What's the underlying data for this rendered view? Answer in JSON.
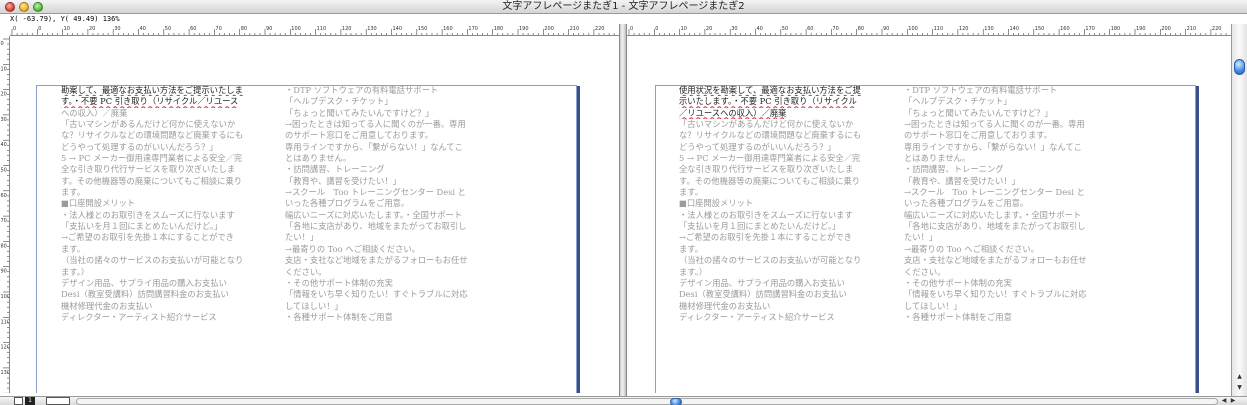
{
  "window": {
    "title": "文字アフレページまたぎ1 - 文字アフレページまたぎ2"
  },
  "coord_readout": "X( -63.79), Y( 49.49)  136%",
  "ruler": {
    "h_labels": [
      "0",
      "0",
      "10",
      "20",
      "30",
      "40",
      "50",
      "60",
      "70",
      "80",
      "90",
      "100",
      "110",
      "120",
      "130",
      "140",
      "150",
      "160",
      "170",
      "180",
      "190",
      "200",
      "210",
      "220"
    ],
    "v_labels": [
      "0",
      "10",
      "20",
      "30",
      "40",
      "50",
      "60",
      "70",
      "80",
      "90",
      "100",
      "110",
      "120",
      "130",
      "140",
      "150",
      "160",
      "170",
      "180",
      "190",
      "200",
      "210",
      "220"
    ]
  },
  "bottombar": {
    "page_number": "1",
    "scroll_left_arrow": "◀",
    "scroll_right_arrow": "▶"
  },
  "scroll": {
    "up_arrow": "▲",
    "down_arrow": "▼"
  },
  "left_pane": {
    "col1": [
      "勘案して、最適なお支払い方法をご提示いたしま",
      "す。・不要 PC 引き取り（リサイクル／リユース",
      "への収入）／廃棄",
      "「古いマシンがあるんだけど何かに使えないか",
      "な？リサイクルなどの環境問題など廃棄するにも",
      "どうやって処理するのがいいんだろう？」",
      "5 → PC メーカー御用達専門業者による安全／完",
      "全な引き取り代行サービスを取り次ぎいたしま",
      "す。その他機器等の廃棄についてもご相談に乗り",
      "ます。",
      "■口座開設メリット",
      "・法人様とのお取引きをスムーズに行ないます",
      "「支払いを月１回にまとめたいんだけど。」",
      "→ご希望のお取引を先掛１本にすることができ",
      "ます。",
      "（当社の諸々のサービスのお支払いが可能となり",
      "ます。）",
      "デザイン用品、サプライ用品の購入お支払い",
      "Desi（教室受講料）訪問講習料金のお支払い",
      "機材修理代金のお支払い",
      "ディレクター・アーティスト紹介サービス"
    ],
    "col2": [
      "・DTP ソフトウェアの有料電話サポート",
      "「ヘルプデスク・チケット」",
      "「ちょっと聞いてみたいんですけど？」",
      "→困ったときは知ってる人に聞くのが一番。専用",
      "のサポート窓口をご用意しております。",
      "専用ラインですから、「繋がらない！」なんてこ",
      "とはありません。",
      "・訪問講習、トレーニング",
      "「教育や、講習を受けたい！」",
      "→スクール　Too トレーニングセンター Desi と",
      "いった各種プログラムをご用意。",
      "幅広いニーズに対応いたします。・全国サポート",
      "「各地に支店があり、地域をまたがってお取引し",
      "たい！」",
      "→最寄りの Too へご相談ください。",
      "支店・支社など地域をまたがるフォローもお任せ",
      "ください。",
      "・その他サポート体制の充実",
      "「情報をいち早く知りたい！すぐトラブルに対応",
      "してほしい！」",
      "・各種サポート体制をご用意"
    ]
  },
  "right_pane": {
    "col1": [
      "使用状況を勘案して、最適なお支払い方法をご提",
      "示いたします。・不要 PC 引き取り（リサイクル",
      "／リユースへの収入）／廃棄",
      "「古いマシンがあるんだけど何かに使えないか",
      "な？リサイクルなどの環境問題など廃棄するにも",
      "どうやって処理するのがいいんだろう？」",
      "5 → PC メーカー御用達専門業者による安全／完",
      "全な引き取り代行サービスを取り次ぎいたしま",
      "す。その他機器等の廃棄についてもご相談に乗り",
      "ます。",
      "■口座開設メリット",
      "・法人様とのお取引きをスムーズに行ないます",
      "「支払いを月１回にまとめたいんだけど。」",
      "→ご希望のお取引を先掛１本にすることができ",
      "ます。",
      "（当社の諸々のサービスのお支払いが可能となり",
      "ます。）",
      "デザイン用品、サプライ用品の購入お支払い",
      "Desi（教室受講料）訪問講習料金のお支払い",
      "機材修理代金のお支払い",
      "ディレクター・アーティスト紹介サービス"
    ],
    "col2": [
      "・DTP ソフトウェアの有料電話サポート",
      "「ヘルプデスク・チケット」",
      "「ちょっと聞いてみたいんですけど？」",
      "→困ったときは知ってる人に聞くのが一番。専用",
      "のサポート窓口をご用意しております。",
      "専用ラインですから、「繋がらない！」なんてこ",
      "とはありません。",
      "・訪問講習、トレーニング",
      "「教育や、講習を受けたい！」",
      "→スクール　Too トレーニングセンター Desi と",
      "いった各種プログラムをご用意。",
      "幅広いニーズに対応いたします。・全国サポート",
      "「各地に支店があり、地域をまたがってお取引し",
      "たい！」",
      "→最寄りの Too へご相談ください。",
      "支店・支社など地域をまたがるフォローもお任せ",
      "ください。",
      "・その他サポート体制の充実",
      "「情報をいち早く知りたい！すぐトラブルに対応",
      "してほしい！」",
      "・各種サポート体制をご用意"
    ]
  },
  "colors": {
    "body_text": "#9b9b9b",
    "selected_text": "#222222",
    "spell_underline": "#d62a2a",
    "page_border": "#8aa0c8",
    "accent_blue": "#4d93e6"
  }
}
